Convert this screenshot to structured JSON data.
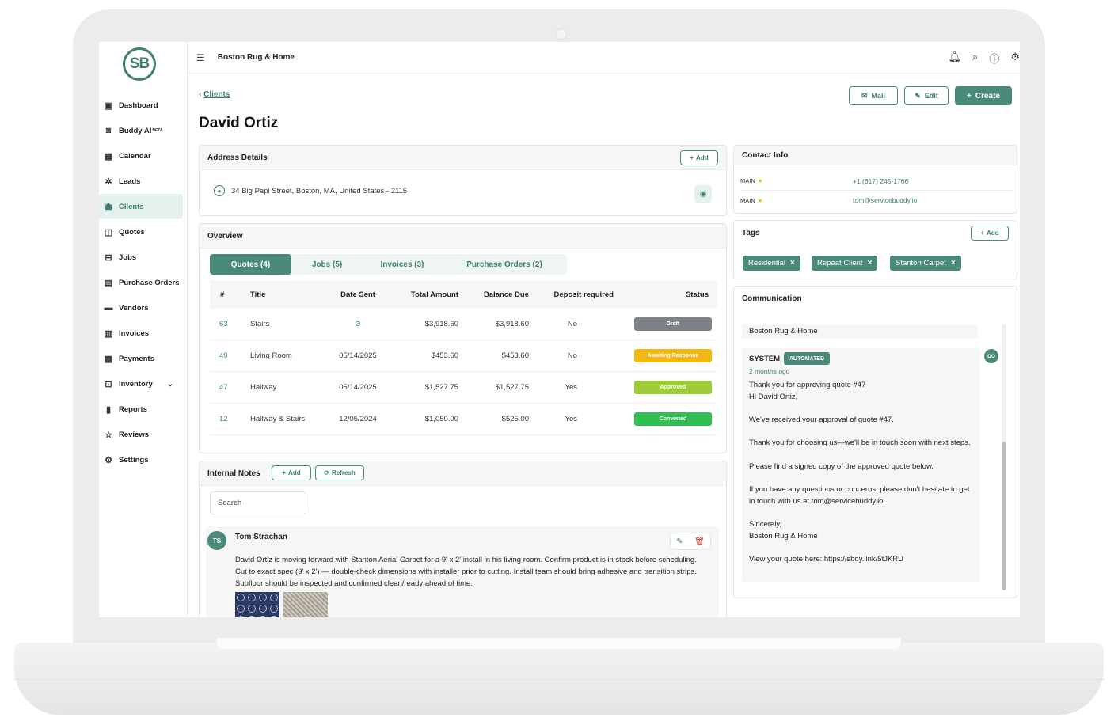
{
  "app": {
    "logo": "SB",
    "company": "Boston Rug & Home"
  },
  "sidebar": {
    "items": [
      {
        "label": "Dashboard",
        "icon": "dashboard-icon"
      },
      {
        "label": "Buddy AI",
        "badge": "BETA",
        "icon": "robot-icon"
      },
      {
        "label": "Calendar",
        "icon": "calendar-icon"
      },
      {
        "label": "Leads",
        "icon": "leads-icon"
      },
      {
        "label": "Clients",
        "icon": "clients-icon",
        "active": true
      },
      {
        "label": "Quotes",
        "icon": "quotes-icon"
      },
      {
        "label": "Jobs",
        "icon": "jobs-icon"
      },
      {
        "label": "Purchase Orders",
        "icon": "purchase-orders-icon"
      },
      {
        "label": "Vendors",
        "icon": "vendors-icon"
      },
      {
        "label": "Invoices",
        "icon": "invoices-icon"
      },
      {
        "label": "Payments",
        "icon": "payments-icon"
      },
      {
        "label": "Inventory",
        "icon": "inventory-icon"
      },
      {
        "label": "Reports",
        "icon": "reports-icon"
      },
      {
        "label": "Reviews",
        "icon": "star-icon"
      },
      {
        "label": "Settings",
        "icon": "gear-icon"
      }
    ]
  },
  "header": {
    "breadcrumb": "Clients",
    "title": "David Ortiz",
    "mail_label": "Mail",
    "edit_label": "Edit",
    "create_label": "Create"
  },
  "address": {
    "title": "Address Details",
    "add_label": "Add",
    "line": "34 Big Papi Street, Boston, MA, United States - 2115"
  },
  "overview": {
    "title": "Overview",
    "tabs": [
      "Quotes (4)",
      "Jobs (5)",
      "Invoices (3)",
      "Purchase Orders (2)"
    ],
    "columns": [
      "#",
      "Title",
      "Date Sent",
      "Total Amount",
      "Balance Due",
      "Deposit required",
      "Status"
    ],
    "rows": [
      {
        "num": "63",
        "title": "Stairs",
        "date": "",
        "total": "$3,918.60",
        "balance": "$3,918.60",
        "deposit": "No",
        "status": "Draft",
        "status_color": "#7d8289"
      },
      {
        "num": "49",
        "title": "Living Room",
        "date": "05/14/2025",
        "total": "$453.60",
        "balance": "$453.60",
        "deposit": "No",
        "status": "Awaiting Response",
        "status_color": "#f3b810"
      },
      {
        "num": "47",
        "title": "Hallway",
        "date": "05/14/2025",
        "total": "$1,527.75",
        "balance": "$1,527.75",
        "deposit": "Yes",
        "status": "Approved",
        "status_color": "#9ccb35"
      },
      {
        "num": "12",
        "title": "Hallway & Stairs",
        "date": "12/05/2024",
        "total": "$1,050.00",
        "balance": "$525.00",
        "deposit": "Yes",
        "status": "Converted",
        "status_color": "#2fbf52"
      }
    ]
  },
  "notes": {
    "title": "Internal Notes",
    "add_label": "Add",
    "refresh_label": "Refresh",
    "search_placeholder": "Search",
    "items": [
      {
        "initials": "TS",
        "author": "Tom Strachan",
        "text": "David Ortiz is moving forward with Stanton Aerial Carpet for a 9' x 2' install in his living room. Confirm product is in stock before scheduling. Cut to exact spec (9' x 2') — double-check dimensions with installer prior to cutting. Install team should bring adhesive and transition strips. Subfloor should be inspected and confirmed clean/ready ahead of time."
      }
    ]
  },
  "contact": {
    "title": "Contact Info",
    "rows": [
      {
        "label": "MAIN",
        "value": "+1 (617) 245-1766"
      },
      {
        "label": "MAIN",
        "value": "tom@servicebuddy.io"
      }
    ]
  },
  "tags": {
    "title": "Tags",
    "add_label": "Add",
    "items": [
      "Residential",
      "Repeat Client",
      "Stanton Carpet"
    ]
  },
  "communication": {
    "title": "Communication",
    "prev_sender": "Boston Rug & Home",
    "sender": "SYSTEM",
    "badge": "AUTOMATED",
    "time": "2 months ago",
    "avatar": "DO",
    "lines": [
      "Thank you for approving quote #47",
      "Hi David Ortiz,",
      "",
      "We've received your approval of quote #47.",
      "",
      "Thank you for choosing us—we'll be in touch soon with next steps.",
      "",
      "Please find a signed copy of the approved quote below.",
      "",
      "If you have any questions or concerns, please don't hesitate to get in touch with us at tom@servicebuddy.io.",
      "",
      "Sincerely,",
      "Boston Rug & Home",
      "",
      "View your quote here: https://sbdy.link/5tJKRU"
    ]
  }
}
